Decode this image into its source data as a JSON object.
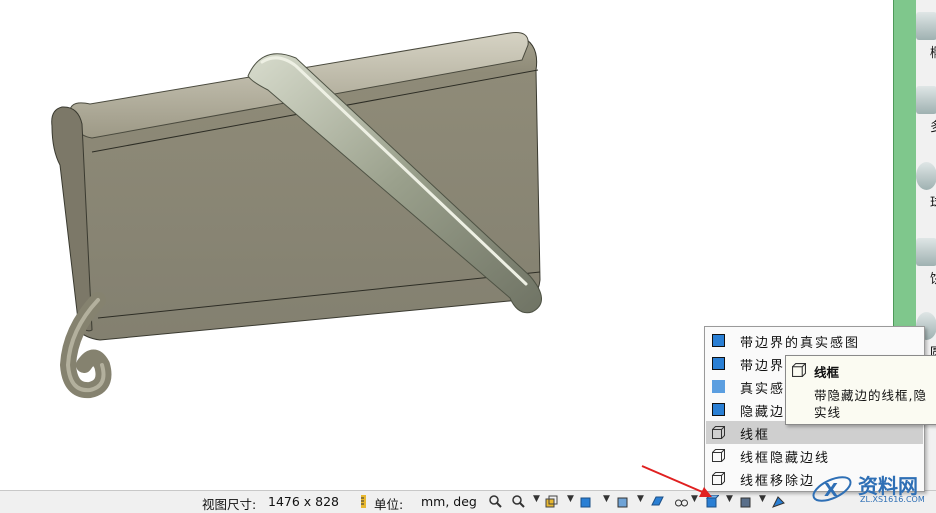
{
  "statusbar": {
    "view_size_label": "视图尺寸:",
    "view_size_value": "1476 x  828",
    "units_label": "单位:",
    "units_value": "mm, deg"
  },
  "display_menu": {
    "items": [
      {
        "label": "带边界的真实感图",
        "selected": false,
        "icon": "shaded-with-edges-icon"
      },
      {
        "label": "带边界",
        "selected": false,
        "icon": "shaded-with-edges-icon"
      },
      {
        "label": "真实感",
        "selected": false,
        "icon": "shaded-icon"
      },
      {
        "label": "隐藏边",
        "selected": false,
        "icon": "shaded-hidden-edges-icon"
      },
      {
        "label": "线框",
        "selected": true,
        "icon": "wireframe-icon"
      },
      {
        "label": "线框隐藏边线",
        "selected": false,
        "icon": "wireframe-icon"
      },
      {
        "label": "线框移除边",
        "selected": false,
        "icon": "wireframe-icon"
      }
    ]
  },
  "tooltip": {
    "title": "线框",
    "desc_line1": "带隐藏边的线框,隐",
    "desc_line2": "实线"
  },
  "palette": {
    "items": [
      {
        "label": "椭圆",
        "icon": "ellipsoid-icon"
      },
      {
        "label": "多棱",
        "icon": "polyhedron-icon"
      },
      {
        "label": "球",
        "icon": "sphere-icon"
      },
      {
        "label": "饼状",
        "icon": "pie-icon"
      },
      {
        "label": "圆",
        "icon": "torus-icon"
      }
    ]
  },
  "watermark": {
    "brand": "资料网",
    "url": "ZL.XS1616.COM"
  },
  "colors": {
    "model_face": "#8b8774",
    "accent_red": "#e02020",
    "palette_green": "#7fc78c",
    "icon_blue": "#2a7fd4"
  }
}
